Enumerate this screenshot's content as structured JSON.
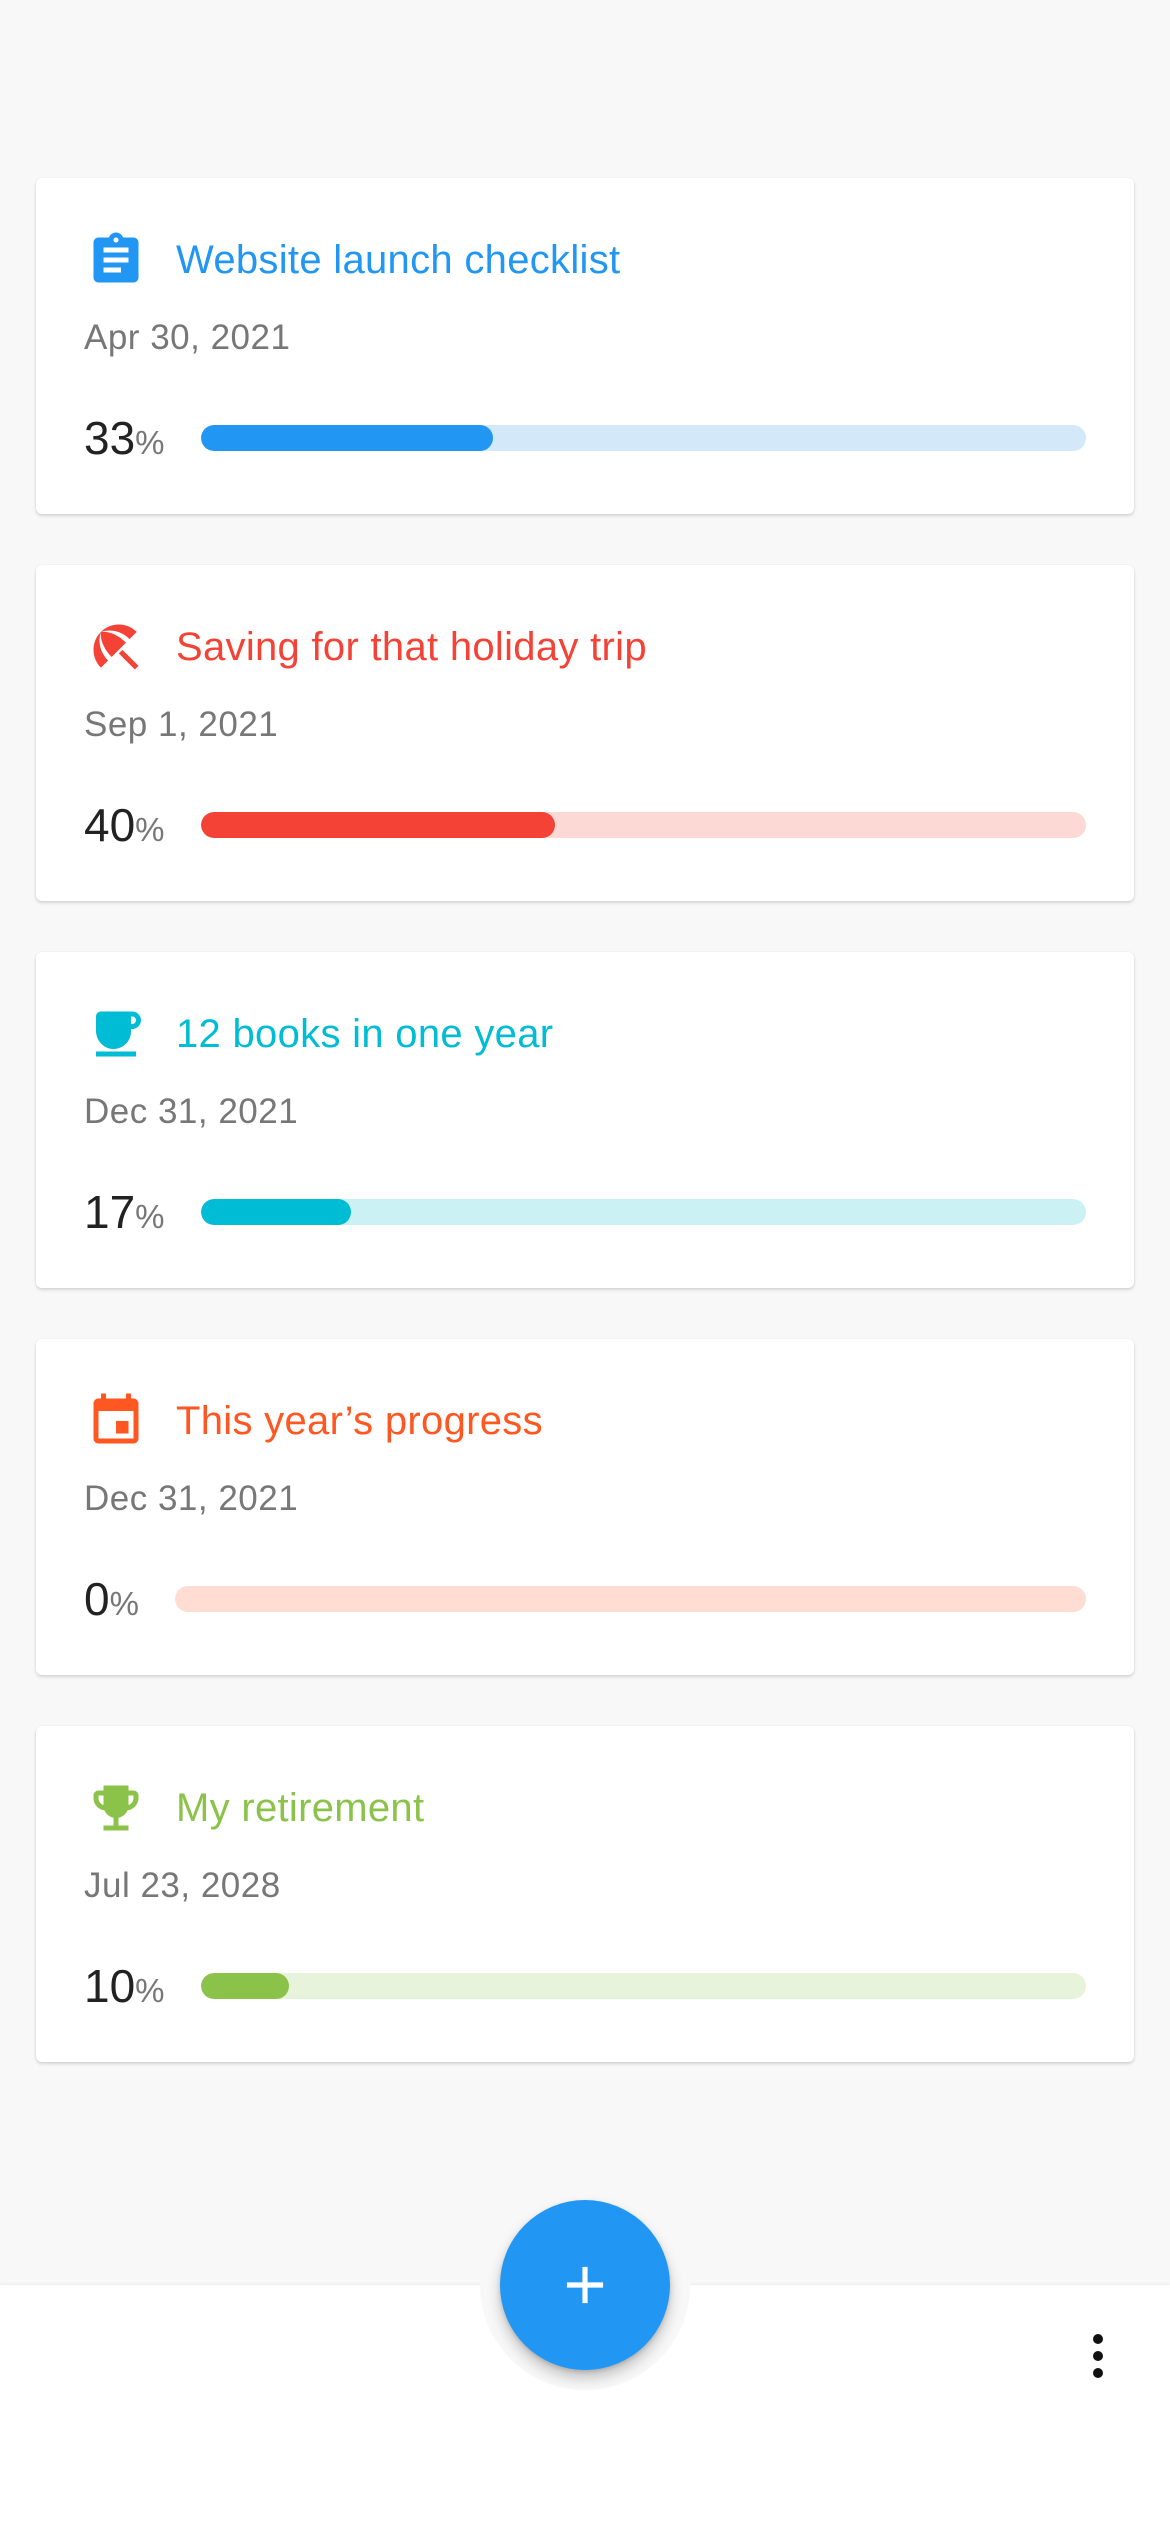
{
  "goals": [
    {
      "title": "Website launch checklist",
      "date": "Apr 30, 2021",
      "percent_value": "33",
      "percent_sign": "%",
      "progress": 0.33,
      "icon": "clipboard-icon",
      "color": "#2196F3",
      "track_color": "#D3E8F9"
    },
    {
      "title": "Saving for that holiday trip",
      "date": "Sep 1, 2021",
      "percent_value": "40",
      "percent_sign": "%",
      "progress": 0.4,
      "icon": "beach-umbrella-icon",
      "color": "#F44336",
      "track_color": "#FDD9D6"
    },
    {
      "title": "12 books in one year",
      "date": "Dec 31, 2021",
      "percent_value": "17",
      "percent_sign": "%",
      "progress": 0.17,
      "icon": "coffee-cup-icon",
      "color": "#00BCD4",
      "track_color": "#CCF1F5"
    },
    {
      "title": "This year’s progress",
      "date": "Dec 31, 2021",
      "percent_value": "0",
      "percent_sign": "%",
      "progress": 0.0,
      "icon": "calendar-icon",
      "color": "#FF5722",
      "track_color": "#FFDDD2"
    },
    {
      "title": "My retirement",
      "date": "Jul 23, 2028",
      "percent_value": "10",
      "percent_sign": "%",
      "progress": 0.1,
      "icon": "trophy-icon",
      "color": "#8BC34A",
      "track_color": "#E8F3DB"
    }
  ],
  "fab": {
    "icon": "plus-icon",
    "color": "#2196F3"
  },
  "bottom_bar": {
    "menu_icon": "more-vertical-icon"
  }
}
